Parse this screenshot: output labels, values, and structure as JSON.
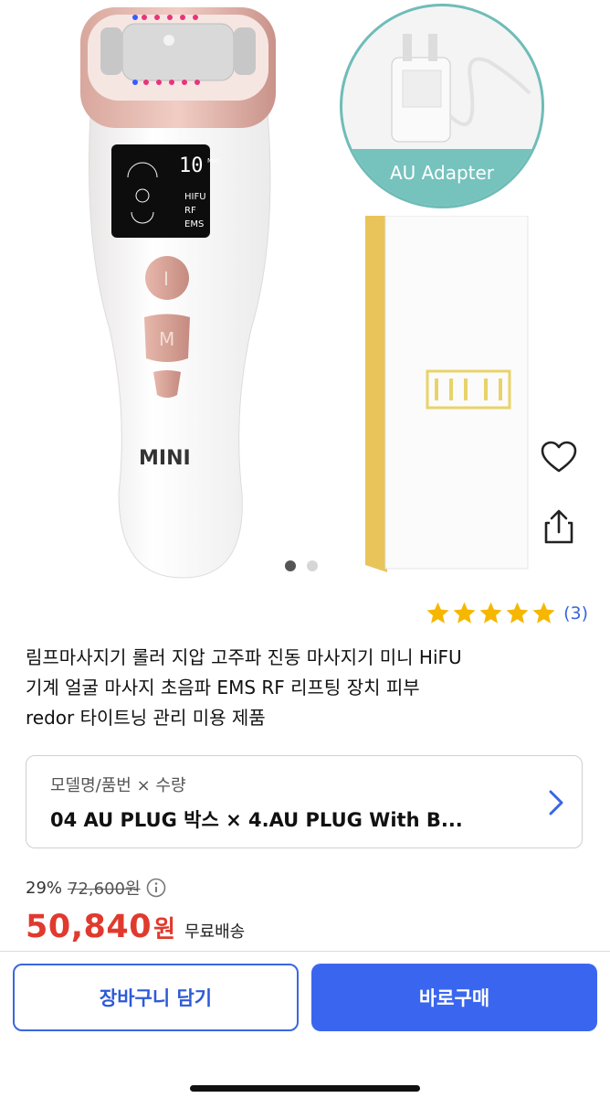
{
  "gallery": {
    "adapter_label": "AU Adapter",
    "screen": {
      "minutes": "10",
      "minutes_unit": "Min",
      "modes": [
        "HIFU",
        "RF",
        "EMS"
      ]
    },
    "buttons": [
      "I",
      "M"
    ],
    "brand": "MINI",
    "page_count": 2,
    "current_page": 1
  },
  "actions": {
    "wishlist_icon": "heart-outline-icon",
    "share_icon": "share-icon"
  },
  "rating": {
    "stars": 5,
    "count": "(3)",
    "star_color": "#f6b700"
  },
  "product": {
    "title_lines": [
      "림프마사지기 롤러 지압 고주파 진동 마사지기 미니 HiFU",
      "기계 얼굴 마사지 초음파 EMS RF 리프팅 장치 피부",
      "redor 타이트닝 관리 미용 제품"
    ]
  },
  "option": {
    "label": "모델명/품번 × 수량",
    "value": "04 AU PLUG  박스 × 4.AU PLUG With B...",
    "chevron_icon": "chevron-right-icon"
  },
  "price": {
    "discount": "29%",
    "original": "72,600원",
    "info_icon": "info-icon",
    "sale": "50,840",
    "currency": "원",
    "shipping": "무료배송",
    "sale_color": "#e03a2e"
  },
  "bottom_bar": {
    "cart_label": "장바구니 담기",
    "buy_label": "바로구매",
    "accent": "#3a66ef"
  }
}
